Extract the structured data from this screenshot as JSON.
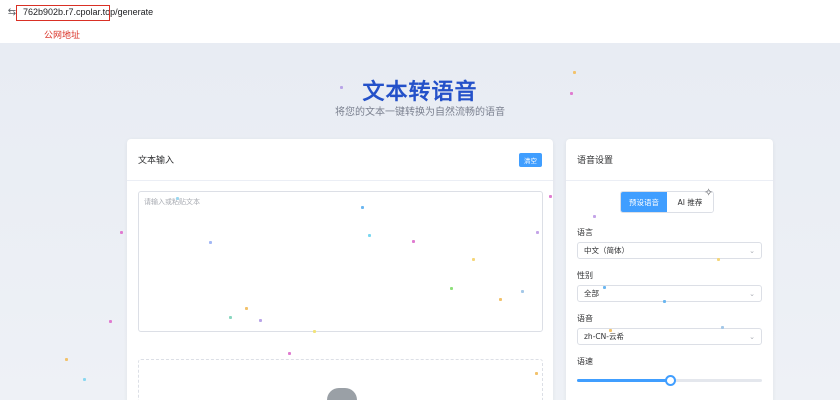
{
  "browser": {
    "url": "762b902b.r7.cpolar.top/generate",
    "annotation": "公网地址"
  },
  "hero": {
    "title": "文本转语音",
    "subtitle": "将您的文本一键转换为自然流畅的语音"
  },
  "text_input": {
    "header": "文本输入",
    "clear_label": "清空",
    "placeholder": "请输入或粘贴文本"
  },
  "voice_settings": {
    "header": "语音设置",
    "tabs": [
      "预设语音",
      "AI 推荐"
    ],
    "language": {
      "label": "语言",
      "value": "中文（简体）"
    },
    "gender": {
      "label": "性别",
      "value": "全部"
    },
    "voice": {
      "label": "语音",
      "value": "zh-CN-云希"
    },
    "speed": {
      "label": "语速",
      "level": 0.5
    }
  },
  "colors": {
    "accent": "#409eff",
    "title": "#2451c9",
    "annotation": "#d93025"
  }
}
